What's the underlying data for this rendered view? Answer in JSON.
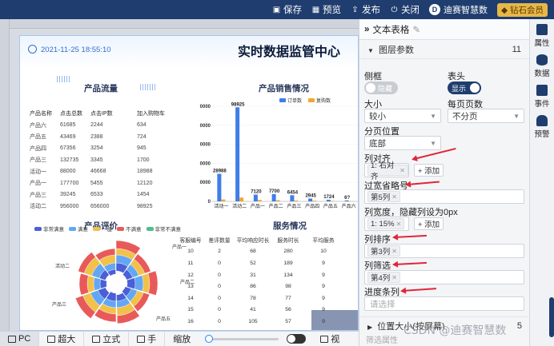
{
  "topbar": {
    "save": "保存",
    "preview": "预览",
    "publish": "发布",
    "close": "关闭",
    "user": "迪赛智慧数",
    "vip": "钻石会员"
  },
  "dashboard": {
    "date": "2021-11-25 18:55:10",
    "title": "实时数据监管中心",
    "product_flow": {
      "title": "产品流量",
      "headers": [
        "产品名称",
        "点击总数",
        "点击IP数",
        "加入购物车"
      ],
      "rows": [
        [
          "产品六",
          "61685",
          "2244",
          "634"
        ],
        [
          "产品五",
          "43469",
          "2388",
          "724"
        ],
        [
          "产品四",
          "67356",
          "3254",
          "945"
        ],
        [
          "产品三",
          "132735",
          "3345",
          "1700"
        ],
        [
          "活动一",
          "88000",
          "46668",
          "18988"
        ],
        [
          "产品一",
          "177700",
          "5455",
          "12120"
        ],
        [
          "产品三",
          "39245",
          "6533",
          "1454"
        ],
        [
          "活动二",
          "956000",
          "656000",
          "98925"
        ]
      ]
    },
    "sales": {
      "title": "产品销售情况"
    },
    "rating": {
      "title": "产品评价",
      "legend": [
        "非常满意",
        "满意",
        "一般",
        "不满意",
        "非常不满意"
      ],
      "labels": [
        "产品一",
        "产品二",
        "活动二",
        "产品三",
        "产品五"
      ]
    },
    "service": {
      "title": "服务情况",
      "headers": [
        "客服编号",
        "差评数量",
        "平均响应时长",
        "服务时长",
        "平均服务"
      ],
      "rows": [
        [
          "10",
          "2",
          "68",
          "280",
          "10"
        ],
        [
          "11",
          "0",
          "52",
          "189",
          "9"
        ],
        [
          "12",
          "0",
          "31",
          "134",
          "9"
        ],
        [
          "13",
          "0",
          "86",
          "98",
          "9"
        ],
        [
          "14",
          "0",
          "78",
          "77",
          "9"
        ],
        [
          "15",
          "0",
          "41",
          "56",
          "9"
        ],
        [
          "16",
          "0",
          "105",
          "57",
          "9"
        ],
        [
          "17",
          "0",
          "",
          "36",
          "9"
        ]
      ]
    }
  },
  "chart_data": {
    "type": "bar",
    "title": "产品销售情况",
    "categories": [
      "活动一",
      "活动二",
      "产品一",
      "产品二",
      "产品三",
      "产品四",
      "产品五",
      "产品六"
    ],
    "series": [
      {
        "name": "订单数",
        "values": [
          28988,
          98925,
          7120,
          7700,
          6454,
          2945,
          1724,
          1000
        ]
      },
      {
        "name": "复购数",
        "values": [
          2000,
          4000,
          1500,
          1200,
          900,
          700,
          500,
          300
        ]
      }
    ],
    "value_labels": [
      "28988",
      "98925",
      "7120",
      "7700",
      "6454",
      "2945",
      "1724",
      "6?"
    ],
    "ylim": [
      0,
      100000
    ],
    "yticks": [
      "0000",
      "0000",
      "0000",
      "0000",
      "0000",
      "0"
    ],
    "colors": [
      "#3f7de8",
      "#f0a630"
    ]
  },
  "panel": {
    "title": "文本表格",
    "section": "图层参数",
    "section_count": "11",
    "sidebar_label": "侧框",
    "sidebar_toggle": "隐藏",
    "header_label": "表头",
    "header_toggle": "显示",
    "size_label": "大小",
    "size_value": "较小",
    "pagesize_label": "每页页数",
    "pagesize_value": "不分页",
    "pagepos_label": "分页位置",
    "pagepos_value": "底部",
    "align_label": "列对齐",
    "align_tag": "1: 右对齐",
    "add": "+ 添加",
    "ellipsis_label": "过宽省略号",
    "ellipsis_tag": "第5列",
    "width_label": "列宽度，隐藏列设为0px",
    "width_tag": "1: 15%",
    "sort_label": "列排序",
    "sort_tag": "第3列",
    "filter_label": "列筛选",
    "filter_tag": "第4列",
    "progress_label": "进度条列",
    "progress_placeholder": "请选择",
    "position_label": "位置大小(按屏幕)",
    "filter_attr": "筛选属性"
  },
  "right_sidebar": [
    "属性",
    "数据",
    "事件",
    "预警"
  ],
  "bottombar": {
    "pc": "PC",
    "xl": "超大",
    "portrait": "立式",
    "hand": "手",
    "zoom": "缩放",
    "view": "视"
  },
  "watermark": "CSDN @迪赛智慧数"
}
